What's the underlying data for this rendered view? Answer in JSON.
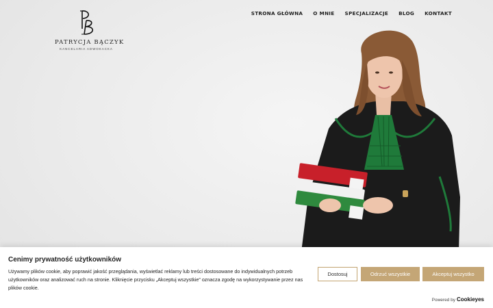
{
  "logo": {
    "monogram": "PB",
    "name": "PATRYCJA BĄCZYK",
    "subtitle": "KANCELARIA ADWOKACKA"
  },
  "nav": {
    "items": [
      {
        "label": "STRONA GŁÓWNA"
      },
      {
        "label": "O MNIE"
      },
      {
        "label": "SPECJALIZACJE"
      },
      {
        "label": "BLOG"
      },
      {
        "label": "KONTAKT"
      }
    ]
  },
  "cookie": {
    "title": "Cenimy prywatność użytkowników",
    "text": "Używamy plików cookie, aby poprawić jakość przeglądania, wyświetlać reklamy lub treści dostosowane do indywidualnych potrzeb użytkowników oraz analizować ruch na stronie. Kliknięcie przycisku „Akceptuj wszystkie” oznacza zgodę na wykorzystywanie przez nas plików cookie.",
    "customize_label": "Dostosuj",
    "reject_label": "Odrzuć wszystkie",
    "accept_label": "Akceptuj wszystko",
    "powered_by": "Powered by",
    "brand": "Cookieyes"
  },
  "colors": {
    "accent": "#c4a676",
    "robe": "#1a1a1a",
    "collar_green": "#1f7a3a",
    "book_red": "#c8202a",
    "book_green": "#2f8a3e"
  }
}
